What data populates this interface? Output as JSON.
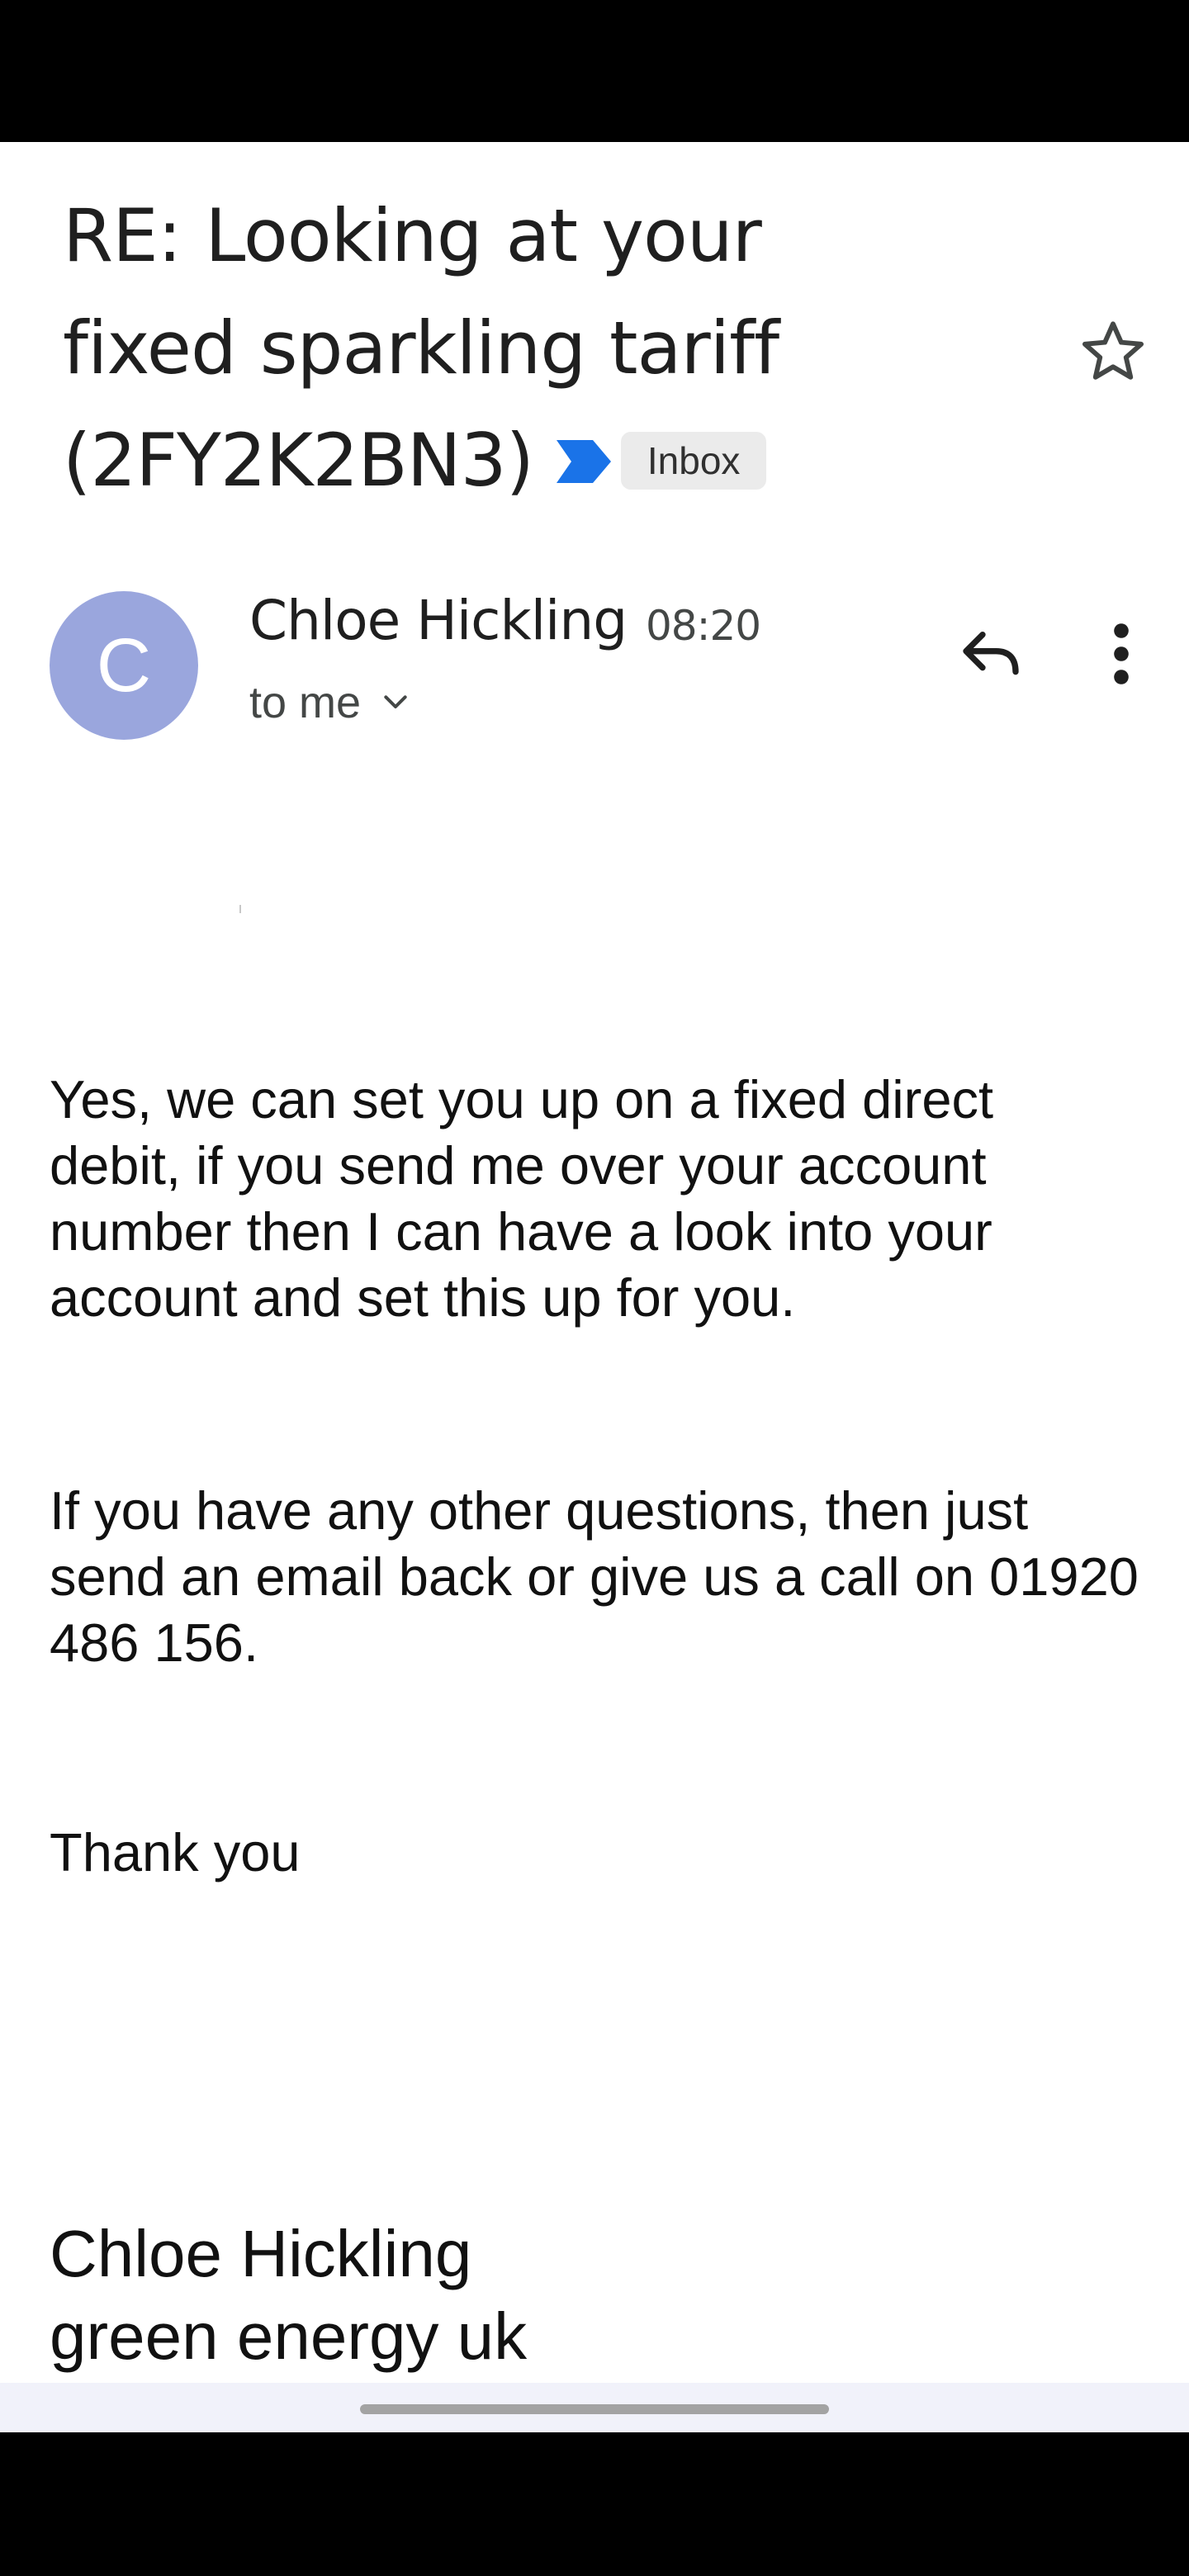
{
  "email": {
    "subject_lines": [
      "RE: Looking at your",
      "fixed sparkling tariff",
      "(2FY2K2BN3)"
    ],
    "label_chip": "Inbox",
    "sender": {
      "avatar_letter": "C",
      "name": "Chloe Hickling",
      "time": "08:20",
      "recipient": "to me"
    },
    "body": {
      "paragraph_1": "Yes, we can set you up on a fixed direct debit, if you send me over your account number then I can have a look into your account and set this up for you.",
      "paragraph_2": "If you have any other questions, then just send an email back or give us a call on 01920 486 156.",
      "closing": "Thank you"
    },
    "signature": {
      "name": "Chloe Hickling",
      "company": "green energy uk"
    }
  },
  "icons": {
    "important": "important-marker-icon",
    "star": "star-icon",
    "reply": "reply-icon",
    "more": "more-vert-icon",
    "expand": "chevron-down-icon"
  },
  "colors": {
    "avatar_bg": "#9aa6dd",
    "important_marker": "#1a73e8",
    "chip_bg": "#ebebeb"
  }
}
